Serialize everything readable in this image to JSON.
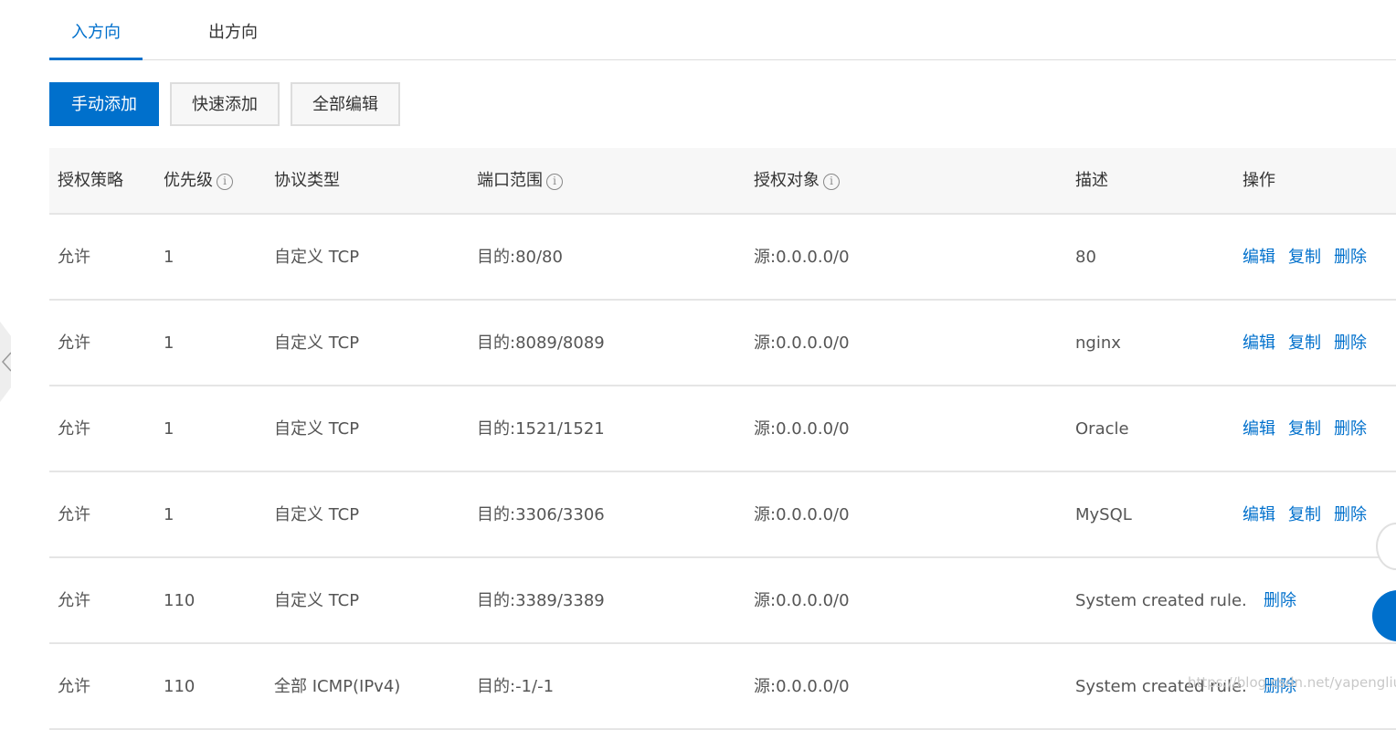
{
  "tabs": {
    "inbound": "入方向",
    "outbound": "出方向"
  },
  "toolbar": {
    "manual_add": "手动添加",
    "quick_add": "快速添加",
    "edit_all": "全部编辑"
  },
  "table": {
    "headers": {
      "policy": "授权策略",
      "priority": "优先级",
      "protocol": "协议类型",
      "port": "端口范围",
      "source": "授权对象",
      "description": "描述",
      "actions": "操作"
    },
    "info_glyph": "i",
    "rows": [
      {
        "policy": "允许",
        "priority": "1",
        "protocol": "自定义 TCP",
        "port": "目的:80/80",
        "source": "源:0.0.0.0/0",
        "description": "80",
        "edit": "编辑",
        "copy": "复制",
        "delete": "删除"
      },
      {
        "policy": "允许",
        "priority": "1",
        "protocol": "自定义 TCP",
        "port": "目的:8089/8089",
        "source": "源:0.0.0.0/0",
        "description": "nginx",
        "edit": "编辑",
        "copy": "复制",
        "delete": "删除"
      },
      {
        "policy": "允许",
        "priority": "1",
        "protocol": "自定义 TCP",
        "port": "目的:1521/1521",
        "source": "源:0.0.0.0/0",
        "description": "Oracle",
        "edit": "编辑",
        "copy": "复制",
        "delete": "删除"
      },
      {
        "policy": "允许",
        "priority": "1",
        "protocol": "自定义 TCP",
        "port": "目的:3306/3306",
        "source": "源:0.0.0.0/0",
        "description": "MySQL",
        "edit": "编辑",
        "copy": "复制",
        "delete": "删除"
      },
      {
        "policy": "允许",
        "priority": "110",
        "protocol": "自定义 TCP",
        "port": "目的:3389/3389",
        "source": "源:0.0.0.0/0",
        "description": "System created rule.",
        "delete": "删除"
      },
      {
        "policy": "允许",
        "priority": "110",
        "protocol": "全部 ICMP(IPv4)",
        "port": "目的:-1/-1",
        "source": "源:0.0.0.0/0",
        "description": "System created rule.",
        "delete": "删除"
      }
    ]
  },
  "watermark": "https://blog.csdn.net/yapengliu",
  "colors": {
    "accent": "#0070cc",
    "header_bg": "#f7f7f7",
    "border": "#e5e5e5"
  },
  "icons": {
    "left_handle": "chevron-left-icon",
    "info": "info-icon"
  }
}
